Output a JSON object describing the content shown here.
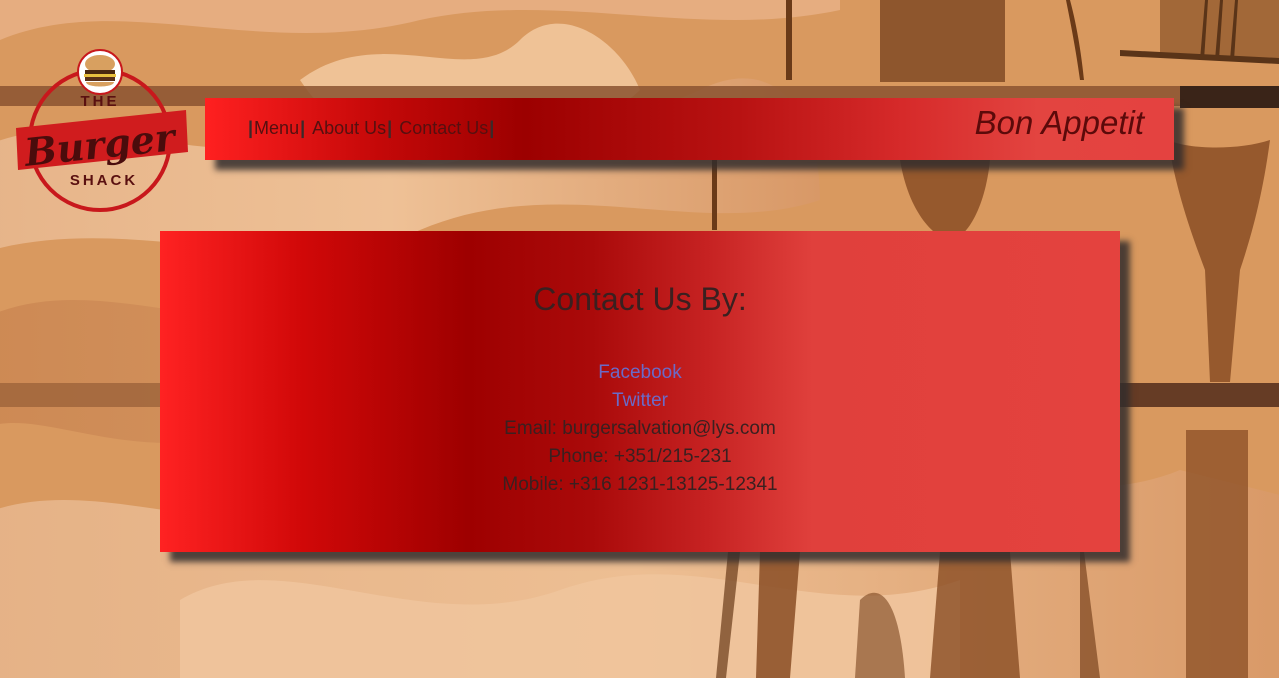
{
  "logo": {
    "line1": "THE",
    "line2": "Burger",
    "line3": "SHACK"
  },
  "nav": {
    "items": [
      {
        "label": "Menu"
      },
      {
        "label": "About Us"
      },
      {
        "label": "Contact Us"
      }
    ],
    "separator": "|",
    "tagline": "Bon Appetit"
  },
  "contact": {
    "title": "Contact Us By:",
    "facebook": "Facebook",
    "twitter": "Twitter",
    "email": "Email: burgersalvation@lys.com",
    "phone": "Phone: +351/215-231",
    "mobile": "Mobile: +316 1231-13125-12341"
  },
  "colors": {
    "accent_red": "#e4423e",
    "dark_red": "#9c0000",
    "link_blue": "#6a6ac8",
    "text_dark": "#3a2020"
  }
}
